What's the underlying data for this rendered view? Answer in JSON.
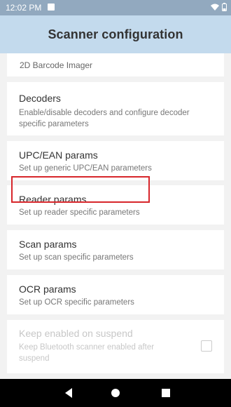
{
  "status_bar": {
    "time": "12:02 PM",
    "icons": [
      "image-icon",
      "wifi-icon",
      "battery-icon"
    ]
  },
  "app_bar": {
    "title": "Scanner configuration"
  },
  "list": {
    "partial_item": "2D Barcode Imager",
    "items": [
      {
        "title": "Decoders",
        "description": "Enable/disable decoders and configure decoder specific parameters"
      },
      {
        "title": "UPC/EAN params",
        "description": "Set up generic UPC/EAN parameters"
      },
      {
        "title": "Reader params",
        "description": "Set up reader specific parameters"
      },
      {
        "title": "Scan params",
        "description": "Set up scan specific parameters",
        "highlighted": true
      },
      {
        "title": "OCR params",
        "description": "Set up OCR specific parameters"
      },
      {
        "title": "Keep enabled on suspend",
        "description": "Keep Bluetooth scanner enabled after suspend",
        "disabled": true,
        "checked": false
      }
    ]
  },
  "nav_bar": {
    "icons": [
      "back-icon",
      "home-icon",
      "recents-icon"
    ]
  },
  "colors": {
    "status_bar": "#92a9bf",
    "app_bar": "#c3daed",
    "background": "#f2f2f2",
    "highlight": "#d7262b"
  }
}
